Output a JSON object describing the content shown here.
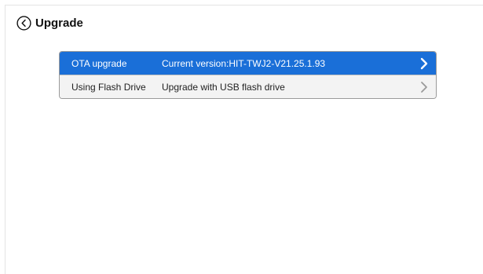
{
  "header": {
    "title": "Upgrade",
    "back_icon": "circle-chevron-left-icon"
  },
  "options": [
    {
      "label": "OTA upgrade",
      "value": "Current version:HIT-TWJ2-V21.25.1.93",
      "icon": "chevron-right-icon",
      "selected": true
    },
    {
      "label": "Using Flash Drive",
      "value": "Upgrade with USB flash drive",
      "icon": "chevron-right-icon",
      "selected": false
    }
  ],
  "colors": {
    "accent": "#1a6fd8",
    "row_background": "#f3f3f3",
    "text": "#222222",
    "chevron_inactive": "#9a9a9a"
  }
}
